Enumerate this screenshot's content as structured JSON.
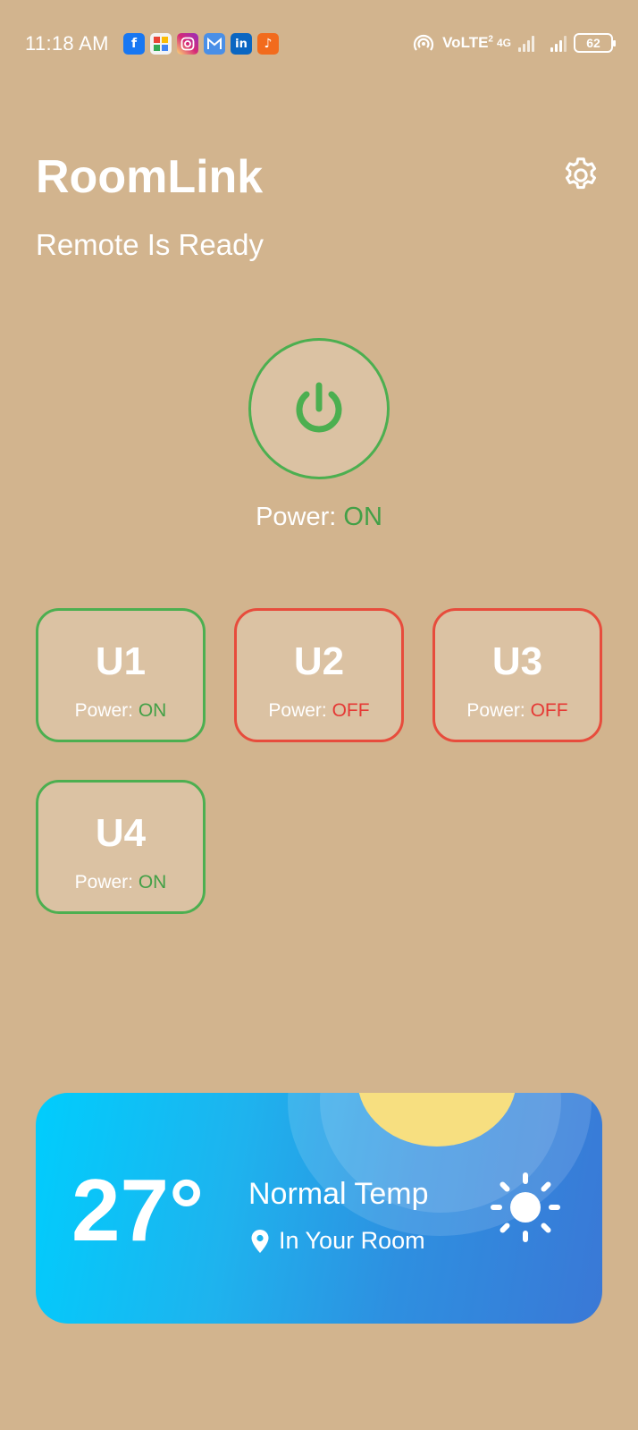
{
  "status_bar": {
    "time": "11:18 AM",
    "notification_icons": [
      {
        "name": "facebook-icon",
        "glyph": "f",
        "color": "#1877f2"
      },
      {
        "name": "photos-icon",
        "glyph": "✿",
        "color": "#f3f3f3"
      },
      {
        "name": "instagram-icon",
        "glyph": "◎",
        "color": "#d62976"
      },
      {
        "name": "mail-icon",
        "glyph": "M",
        "color": "#4a8fe7"
      },
      {
        "name": "linkedin-icon",
        "glyph": "in",
        "color": "#0a66c2"
      },
      {
        "name": "app-icon",
        "glyph": "♪",
        "color": "#f26b1d"
      }
    ],
    "network_label": "VoLTE",
    "network_sub": "2",
    "network_type": "4G",
    "battery_level": "62"
  },
  "header": {
    "title": "RoomLink",
    "subtitle": "Remote Is Ready",
    "settings_icon": "gear-icon"
  },
  "main_power": {
    "label": "Power: ",
    "state": "ON",
    "icon": "power-icon",
    "on_color": "#43a047"
  },
  "units": [
    {
      "name": "U1",
      "power_label": "Power: ",
      "state": "ON"
    },
    {
      "name": "U2",
      "power_label": "Power: ",
      "state": "OFF"
    },
    {
      "name": "U3",
      "power_label": "Power: ",
      "state": "OFF"
    },
    {
      "name": "U4",
      "power_label": "Power: ",
      "state": "ON"
    }
  ],
  "colors": {
    "background": "#d2b48e",
    "on": "#43a047",
    "off": "#e53935",
    "card_on_border": "#4caf50",
    "card_off_border": "#e74c3c"
  },
  "weather": {
    "temperature": "27°",
    "condition": "Normal Temp",
    "location": "In Your Room",
    "location_icon": "map-pin-icon",
    "weather_icon": "sun-icon"
  }
}
